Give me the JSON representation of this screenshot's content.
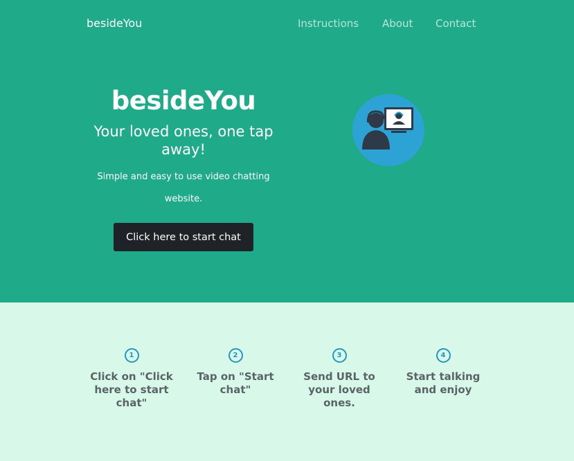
{
  "navbar": {
    "brand": "besideYou",
    "links": [
      "Instructions",
      "About",
      "Contact"
    ]
  },
  "hero": {
    "title": "besideYou",
    "tagline": "Your loved ones, one tap away!",
    "description": "Simple and easy to use video chatting website.",
    "cta_label": "Click here to start chat",
    "illustration_icon": "video-chat-icon"
  },
  "steps": [
    {
      "number": "1",
      "text": "Click on \"Click here to start chat\""
    },
    {
      "number": "2",
      "text": "Tap on \"Start chat\""
    },
    {
      "number": "3",
      "text": "Send URL to your loved ones."
    },
    {
      "number": "4",
      "text": "Start talking and enjoy"
    }
  ],
  "colors": {
    "hero_bg": "#1faa89",
    "steps_bg": "#d8f8e9",
    "button_bg": "#1f2226",
    "accent": "#2596c2"
  }
}
